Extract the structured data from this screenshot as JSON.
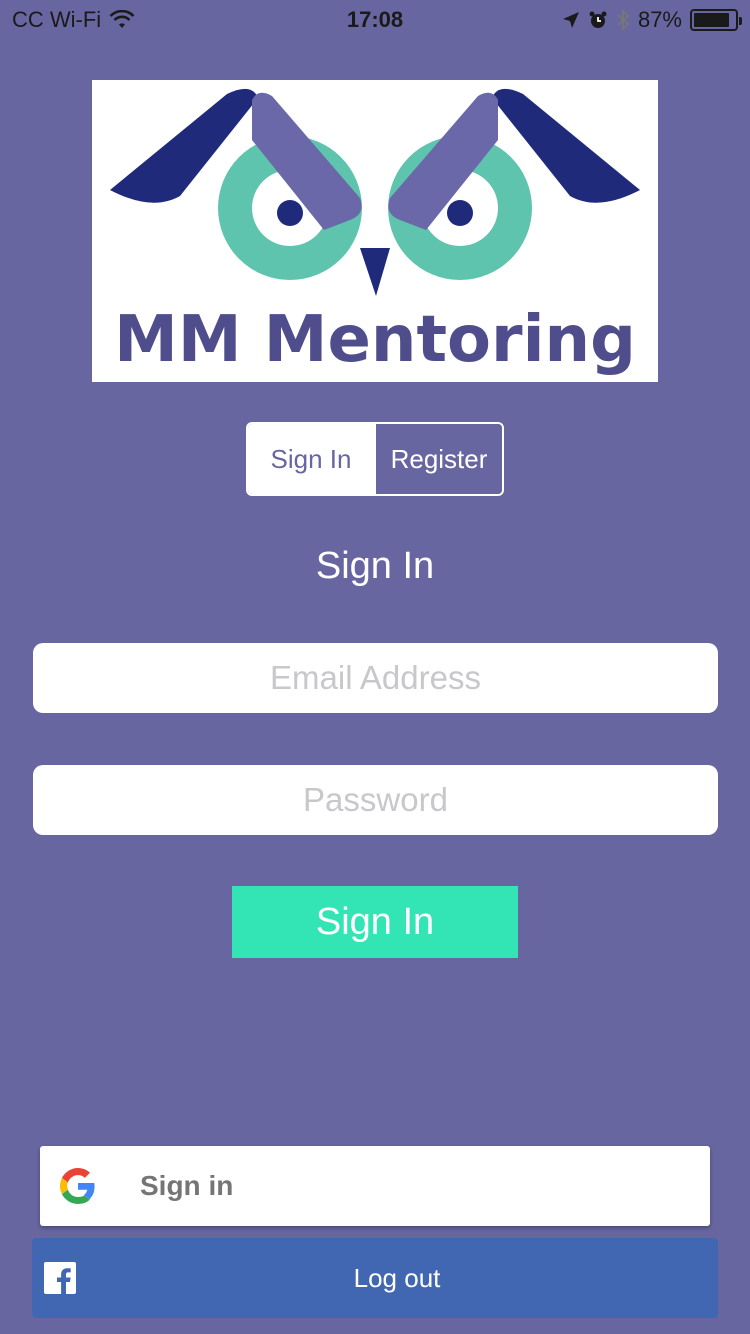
{
  "status_bar": {
    "carrier": "CC Wi-Fi",
    "time": "17:08",
    "battery": "87%",
    "battery_level": 0.87,
    "icons": [
      "wifi-icon",
      "location-arrow-icon",
      "alarm-icon",
      "bluetooth-icon",
      "battery-icon"
    ]
  },
  "logo": {
    "text": "MM Mentoring",
    "colors": {
      "navy": "#1f2a7a",
      "lavender": "#6a68a8",
      "teal": "#5fc4ae",
      "text": "#4f4d8c"
    }
  },
  "segmented": {
    "items": [
      {
        "label": "Sign In",
        "selected": true
      },
      {
        "label": "Register",
        "selected": false
      }
    ]
  },
  "form": {
    "title": "Sign In",
    "email_placeholder": "Email Address",
    "email_value": "",
    "password_placeholder": "Password",
    "password_value": "",
    "submit_label": "Sign In"
  },
  "social": {
    "google_label": "Sign in",
    "facebook_label": "Log out"
  },
  "colors": {
    "background": "#6866a0",
    "accent": "#33e5b5",
    "facebook": "#4267b2"
  }
}
